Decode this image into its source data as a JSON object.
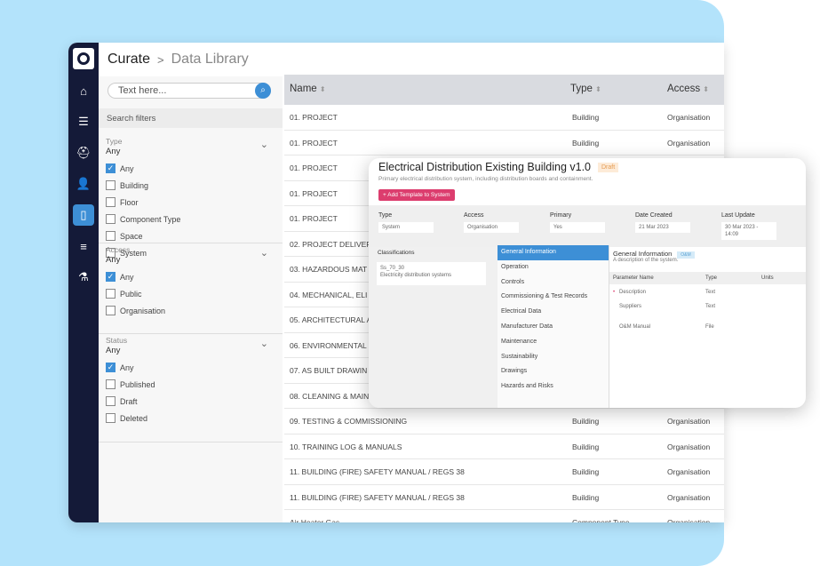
{
  "header": {
    "app": "Curate",
    "separator": ">",
    "page": "Data Library"
  },
  "sidebar": {
    "items": [
      {
        "icon": "home-icon"
      },
      {
        "icon": "checklist-icon"
      },
      {
        "icon": "hard-hat-icon"
      },
      {
        "icon": "user-settings-icon"
      },
      {
        "icon": "document-icon",
        "active": true
      },
      {
        "icon": "sliders-icon"
      },
      {
        "icon": "flask-icon"
      }
    ]
  },
  "filters": {
    "search_placeholder": "Text here...",
    "title": "Search filters",
    "groups": [
      {
        "label": "Type",
        "value": "Any",
        "options": [
          {
            "label": "Any",
            "checked": true
          },
          {
            "label": "Building"
          },
          {
            "label": "Floor"
          },
          {
            "label": "Component Type"
          },
          {
            "label": "Space"
          },
          {
            "label": "System"
          }
        ]
      },
      {
        "label": "Access",
        "value": "Any",
        "options": [
          {
            "label": "Any",
            "checked": true
          },
          {
            "label": "Public"
          },
          {
            "label": "Organisation"
          }
        ]
      },
      {
        "label": "Status",
        "value": "Any",
        "options": [
          {
            "label": "Any",
            "checked": true
          },
          {
            "label": "Published"
          },
          {
            "label": "Draft"
          },
          {
            "label": "Deleted"
          }
        ]
      }
    ]
  },
  "table": {
    "columns": [
      "Name",
      "Type",
      "Access"
    ],
    "rows": [
      [
        "01. PROJECT",
        "Building",
        "Organisation"
      ],
      [
        "01. PROJECT",
        "Building",
        "Organisation"
      ],
      [
        "01. PROJECT",
        "",
        ""
      ],
      [
        "01. PROJECT",
        "",
        ""
      ],
      [
        "01. PROJECT",
        "",
        ""
      ],
      [
        "02. PROJECT DELIVER",
        "",
        ""
      ],
      [
        "03. HAZARDOUS MAT",
        "",
        ""
      ],
      [
        "04. MECHANICAL, ELI",
        "",
        ""
      ],
      [
        "05. ARCHITECTURAL A",
        "",
        ""
      ],
      [
        "06. ENVIRONMENTAL",
        "",
        ""
      ],
      [
        "07. AS BUILT DRAWIN",
        "",
        ""
      ],
      [
        "08. CLEANING & MAIN",
        "",
        ""
      ],
      [
        "09. TESTING & COMMISSIONING",
        "Building",
        "Organisation"
      ],
      [
        "10. TRAINING LOG & MANUALS",
        "Building",
        "Organisation"
      ],
      [
        "11.  BUILDING (FIRE) SAFETY MANUAL / REGS 38",
        "Building",
        "Organisation"
      ],
      [
        "11.  BUILDING (FIRE) SAFETY MANUAL / REGS 38",
        "Building",
        "Organisation"
      ],
      [
        "Air Heater Gas",
        "Component Type",
        "Organisation"
      ]
    ]
  },
  "popup": {
    "title": "Electrical Distribution Existing Building v1.0",
    "status": "Draft",
    "description": "Primary electrical distribution system, including distribution boards and containment.",
    "add_button": "+ Add Template to System",
    "meta": [
      {
        "label": "Type",
        "value": "System"
      },
      {
        "label": "Access",
        "value": "Organisation"
      },
      {
        "label": "Primary",
        "value": "Yes"
      },
      {
        "label": "Date Created",
        "value": "21 Mar 2023"
      },
      {
        "label": "Last Update",
        "value": "30 Mar 2023 - 14:09"
      }
    ],
    "classifications": {
      "title": "Classifications",
      "code": "Ss_70_30",
      "name": "Electricity distribution systems"
    },
    "sections": [
      "General Information",
      "Operation",
      "Controls",
      "Commissioning & Test Records",
      "Electrical Data",
      "Manufacturer Data",
      "Maintenance",
      "Sustainability",
      "Drawings",
      "Hazards and Risks"
    ],
    "detail": {
      "title": "General Information",
      "tag": "O&M",
      "description": "A description of the system.",
      "columns": [
        "Parameter Name",
        "Type",
        "Units"
      ],
      "params": [
        {
          "name": "Description",
          "type": "Text",
          "required": true
        },
        {
          "name": "Suppliers",
          "type": "Text"
        },
        {
          "name": "O&M Manual",
          "type": "File"
        }
      ]
    }
  },
  "colors": {
    "accent": "#3d8fd6",
    "sidebar": "#141a38",
    "button": "#dc3d6e",
    "background": "#b3e3fb"
  }
}
